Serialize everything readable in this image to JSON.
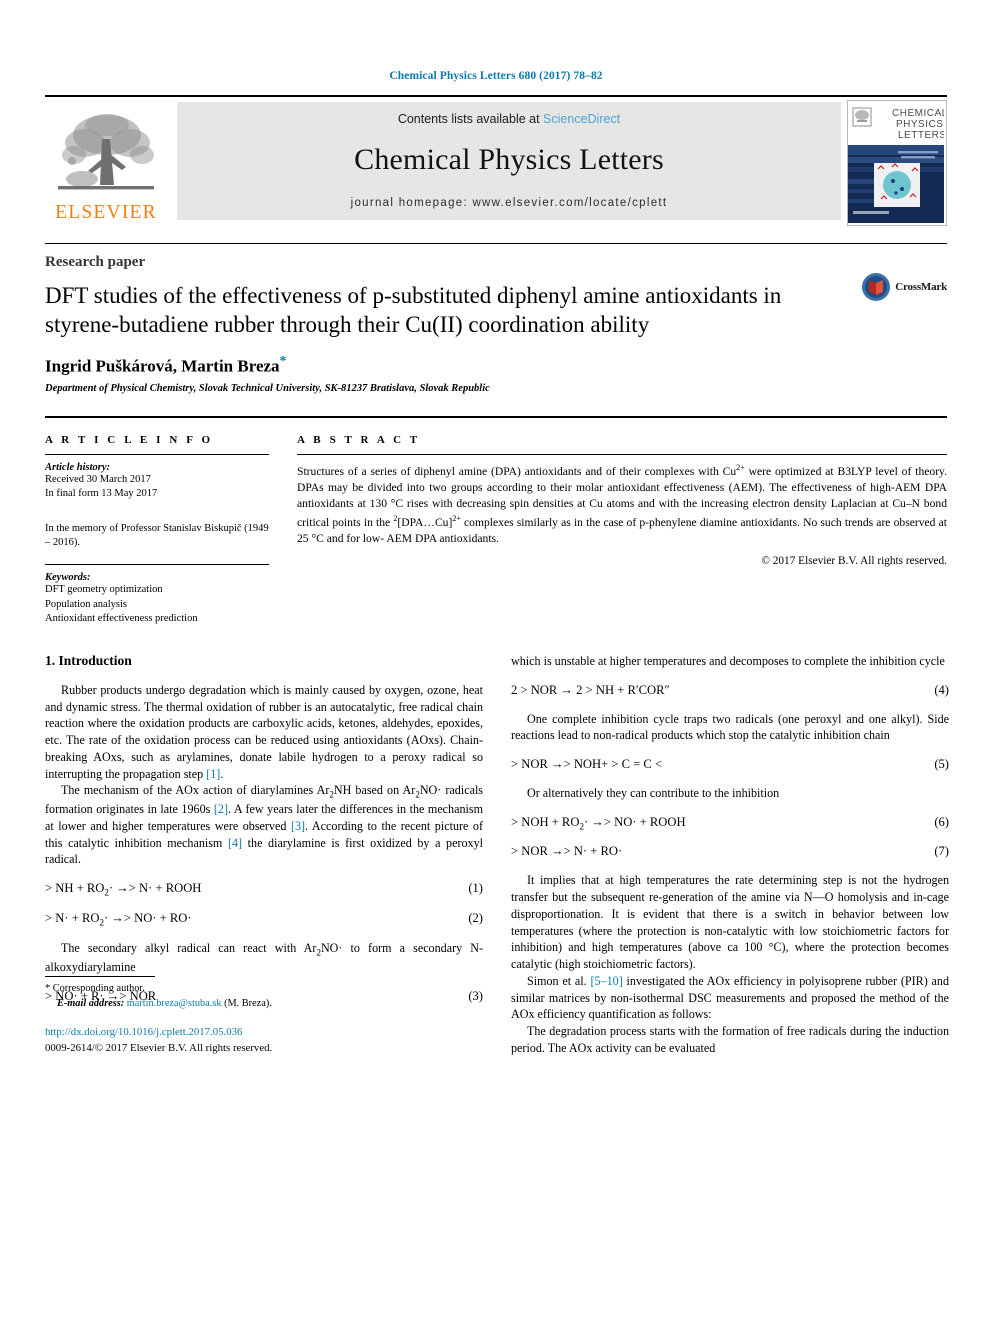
{
  "running_head": "Chemical Physics Letters 680 (2017) 78–82",
  "masthead": {
    "contents_prefix": "Contents lists available at ",
    "sciencedirect": "ScienceDirect",
    "journal_title": "Chemical Physics Letters",
    "homepage": "journal homepage: www.elsevier.com/locate/cplett",
    "publisher_logo_text": "ELSEVIER",
    "cover_line1": "CHEMICAL",
    "cover_line2": "PHYSICS",
    "cover_line3": "LETTERS",
    "accent_blue": "#0b7aab",
    "elsevier_orange": "#f07e13"
  },
  "title_block": {
    "article_type": "Research paper",
    "title": "DFT studies of the effectiveness of p-substituted diphenyl amine antioxidants in styrene-butadiene rubber through their Cu(II) coordination ability",
    "authors": "Ingrid Puškárová, Martin Breza",
    "corresponding_marker": "*",
    "affiliation": "Department of Physical Chemistry, Slovak Technical University, SK-81237 Bratislava, Slovak Republic",
    "crossmark_label": "CrossMark"
  },
  "article_info": {
    "heading": "A R T I C L E   I N F O",
    "history_label": "Article history:",
    "history": [
      "Received 30 March 2017",
      "In final form 13 May 2017"
    ],
    "memorial": "In the memory of Professor Stanislav Biskupič (1949 – 2016).",
    "keywords_label": "Keywords:",
    "keywords": [
      "DFT geometry optimization",
      "Population analysis",
      "Antioxidant effectiveness prediction"
    ]
  },
  "abstract": {
    "heading": "A B S T R A C T",
    "text_parts": [
      "Structures of a series of diphenyl amine (DPA) antioxidants and of their complexes with Cu",
      "2+",
      " were optimized at B3LYP level of theory. DPAs may be divided into two groups according to their molar antioxidant effectiveness (AEM). The effectiveness of high-AEM DPA antioxidants at 130 °C rises with decreasing spin densities at Cu atoms and with the increasing electron density Laplacian at Cu–N bond critical points in the ",
      "2",
      "[DPA…Cu]",
      "2+",
      " complexes similarly as in the case of p-phenylene diamine antioxidants. No such trends are observed at 25 °C and for low- AEM DPA antioxidants."
    ],
    "copyright": "© 2017 Elsevier B.V. All rights reserved."
  },
  "body": {
    "section_title": "1. Introduction",
    "left_paragraphs": [
      "Rubber products undergo degradation which is mainly caused by oxygen, ozone, heat and dynamic stress. The thermal oxidation of rubber is an autocatalytic, free radical chain reaction where the oxidation products are carboxylic acids, ketones, aldehydes, epoxides, etc. The rate of the oxidation process can be reduced using antioxidants (AOxs). Chain-breaking AOxs, such as arylamines, donate labile hydrogen to a peroxy radical so interrupting the propagation step [1].",
      "The mechanism of the AOx action of diarylamines Ar2NH based on Ar2NO· radicals formation originates in late 1960s [2]. A few years later the differences in the mechanism at lower and higher temperatures were observed [3]. According to the recent picture of this catalytic inhibition mechanism [4] the diarylamine is first oxidized by a peroxyl radical.",
      "The secondary alkyl radical can react with Ar2NO· to form a secondary N-alkoxydiarylamine"
    ],
    "right_paragraphs": [
      "which is unstable at higher temperatures and decomposes to complete the inhibition cycle",
      "One complete inhibition cycle traps two radicals (one peroxyl and one alkyl). Side reactions lead to non-radical products which stop the catalytic inhibition chain",
      "Or alternatively they can contribute to the inhibition",
      "It implies that at high temperatures the rate determining step is not the hydrogen transfer but the subsequent re-generation of the amine via N—O homolysis and in-cage disproportionation. It is evident that there is a switch in behavior between low temperatures (where the protection is non-catalytic with low stoichiometric factors for inhibition) and high temperatures (above ca 100 °C), where the protection becomes catalytic (high stoichiometric factors).",
      "Simon et al. [5–10] investigated the AOx efficiency in polyisoprene rubber (PIR) and similar matrices by non-isothermal DSC measurements and proposed the method of the AOx efficiency quantification as follows:",
      "The degradation process starts with the formation of free radicals during the induction period. The AOx activity can be evaluated"
    ],
    "equations": [
      {
        "body": "> NH + RO2· →> N· + ROOH",
        "number": "(1)"
      },
      {
        "body": "> N· + RO2· →> NO· + RO·",
        "number": "(2)"
      },
      {
        "body": "> NO· + R· →> NOR",
        "number": "(3)"
      },
      {
        "body": "2 > NOR → 2 > NH + R′COR″",
        "number": "(4)"
      },
      {
        "body": "> NOR →> NOH+ > C = C <",
        "number": "(5)"
      },
      {
        "body": "> NOH + RO2· →> NO· + ROOH",
        "number": "(6)"
      },
      {
        "body": "> NOR →> N· + RO·",
        "number": "(7)"
      }
    ]
  },
  "footer": {
    "corresponding_marker": "*",
    "corresponding_text": "Corresponding author.",
    "email_label": "E-mail address:",
    "email": "martin.breza@stuba.sk",
    "email_suffix": "(M. Breza).",
    "doi": "http://dx.doi.org/10.1016/j.cplett.2017.05.036",
    "issn_line": "0009-2614/© 2017 Elsevier B.V. All rights reserved."
  }
}
